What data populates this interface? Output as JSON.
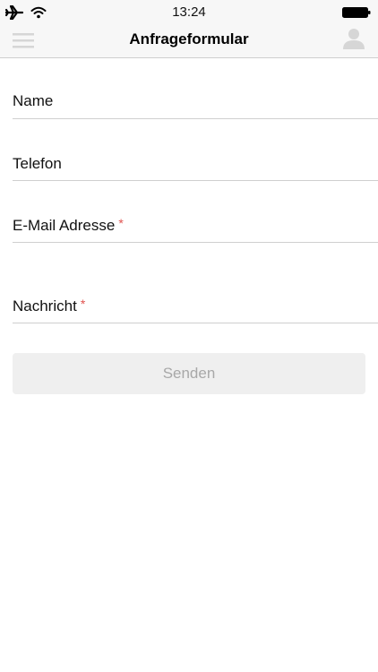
{
  "status_bar": {
    "time": "13:24",
    "icons": [
      "airplane-icon",
      "wifi-icon",
      "battery-icon"
    ]
  },
  "nav": {
    "title": "Anfrageformular",
    "left_icon": "menu-icon",
    "right_icon": "user-icon"
  },
  "form": {
    "fields": [
      {
        "label": "Name",
        "required": false
      },
      {
        "label": "Telefon",
        "required": false
      },
      {
        "label": "E-Mail Adresse",
        "required": true
      },
      {
        "label": "Nachricht",
        "required": true
      }
    ],
    "required_marker": "*",
    "submit_label": "Senden"
  },
  "colors": {
    "bar_background": "#f7f7f7",
    "divider": "#cfcfcf",
    "required": "#e0524f",
    "button_background": "#efefef",
    "button_text": "#a8a8a8"
  }
}
